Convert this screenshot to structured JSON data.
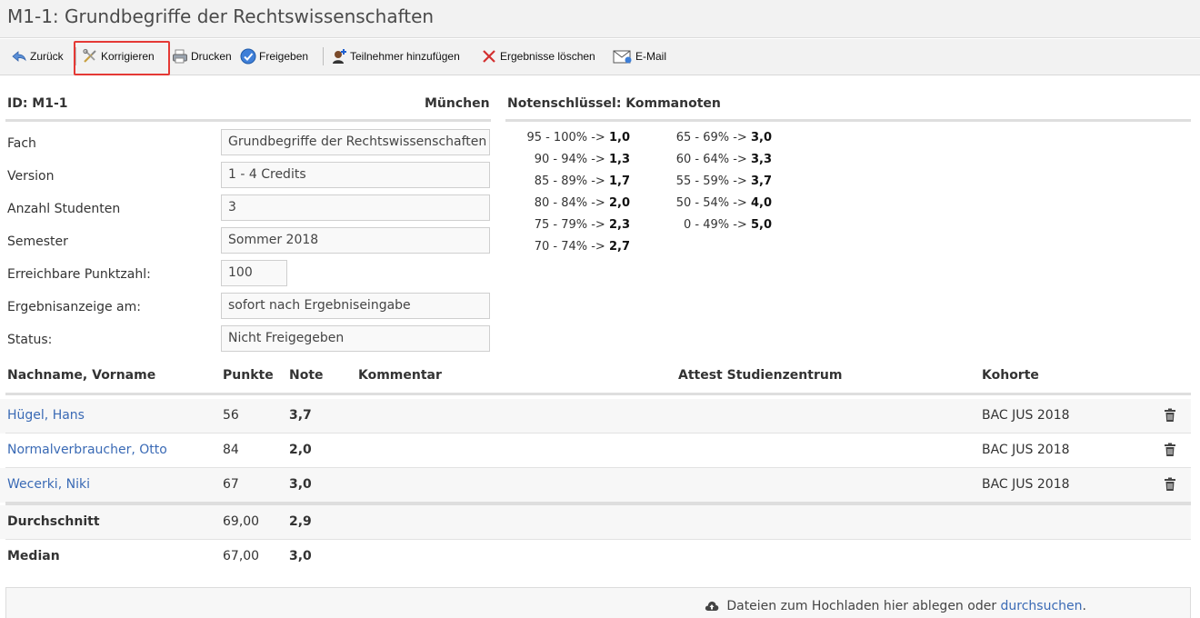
{
  "page_title": "M1-1: Grundbegriffe der Rechtswissenschaften",
  "toolbar": {
    "back": "Zurück",
    "correct": "Korrigieren",
    "print": "Drucken",
    "release": "Freigeben",
    "add_participant": "Teilnehmer hinzufügen",
    "delete_results": "Ergebnisse löschen",
    "email": "E-Mail"
  },
  "info": {
    "id_label": "ID: M1-1",
    "location": "München",
    "fields": [
      {
        "label": "Fach",
        "value": "Grundbegriffe der Rechtswissenschaften"
      },
      {
        "label": "Version",
        "value": "1 - 4 Credits"
      },
      {
        "label": "Anzahl Studenten",
        "value": "3"
      },
      {
        "label": "Semester",
        "value": "Sommer 2018"
      },
      {
        "label": "Erreichbare Punktzahl:",
        "value": "100"
      },
      {
        "label": "Ergebnisanzeige am:",
        "value": "sofort nach Ergebniseingabe"
      },
      {
        "label": "Status:",
        "value": "Nicht Freigegeben"
      }
    ]
  },
  "grading_key": {
    "title": "Notenschlüssel: Kommanoten",
    "col1": [
      {
        "range": "95 - 100% ->",
        "grade": "1,0"
      },
      {
        "range": "90 - 94% ->",
        "grade": "1,3"
      },
      {
        "range": "85 - 89% ->",
        "grade": "1,7"
      },
      {
        "range": "80 - 84% ->",
        "grade": "2,0"
      },
      {
        "range": "75 - 79% ->",
        "grade": "2,3"
      },
      {
        "range": "70 - 74% ->",
        "grade": "2,7"
      }
    ],
    "col2": [
      {
        "range": "65 - 69% ->",
        "grade": "3,0"
      },
      {
        "range": "60 - 64% ->",
        "grade": "3,3"
      },
      {
        "range": "55 - 59% ->",
        "grade": "3,7"
      },
      {
        "range": "50 - 54% ->",
        "grade": "4,0"
      },
      {
        "range": "0 - 49% ->",
        "grade": "5,0"
      }
    ]
  },
  "table": {
    "headers": {
      "name": "Nachname, Vorname",
      "points": "Punkte",
      "grade": "Note",
      "comment": "Kommentar",
      "attest": "Attest Studienzentrum",
      "cohort": "Kohorte"
    },
    "rows": [
      {
        "name": "Hügel, Hans",
        "points": "56",
        "grade": "3,7",
        "cohort": "BAC JUS 2018"
      },
      {
        "name": "Normalverbraucher, Otto",
        "points": "84",
        "grade": "2,0",
        "cohort": "BAC JUS 2018"
      },
      {
        "name": "Wecerki, Niki",
        "points": "67",
        "grade": "3,0",
        "cohort": "BAC JUS 2018"
      }
    ],
    "average": {
      "label": "Durchschnitt",
      "points": "69,00",
      "grade": "2,9"
    },
    "median": {
      "label": "Median",
      "points": "67,00",
      "grade": "3,0"
    }
  },
  "dropzone": {
    "text": "Dateien zum Hochladen hier ablegen oder",
    "link": "durchsuchen",
    "suffix": "."
  },
  "colors": {
    "link": "#3a6ab5",
    "highlight": "#e53935",
    "delete_x": "#d32f2f"
  }
}
